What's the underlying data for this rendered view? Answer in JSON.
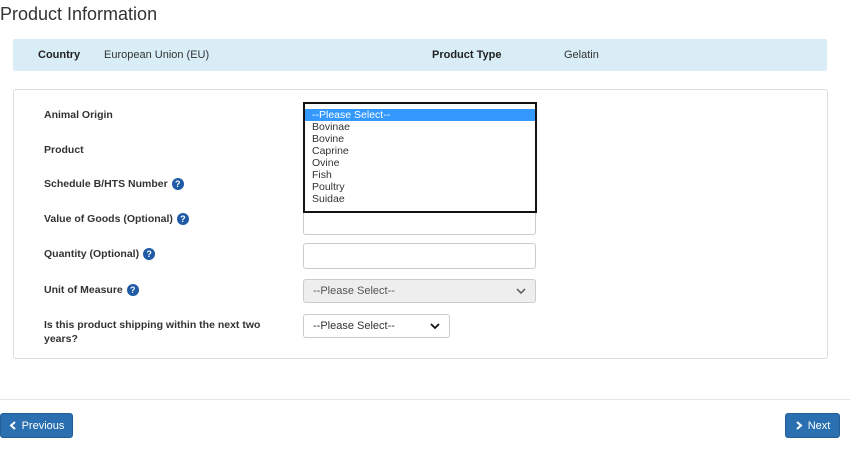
{
  "page": {
    "title": "Product Information"
  },
  "summary": {
    "country_label": "Country",
    "country_value": "European Union (EU)",
    "product_type_label": "Product Type",
    "product_type_value": "Gelatin"
  },
  "form": {
    "animal_origin": {
      "label": "Animal Origin",
      "options": [
        "--Please Select--",
        "Bovinae",
        "Bovine",
        "Caprine",
        "Ovine",
        "Fish",
        "Poultry",
        "Suidae"
      ],
      "selected": "--Please Select--"
    },
    "product": {
      "label": "Product"
    },
    "hts_number": {
      "label": "Schedule B/HTS Number"
    },
    "value_of_goods": {
      "label": "Value of Goods (Optional)",
      "value": ""
    },
    "quantity": {
      "label": "Quantity  (Optional)",
      "value": ""
    },
    "unit_of_measure": {
      "label": "Unit of Measure",
      "selected": "--Please Select--"
    },
    "shipping_two_years": {
      "label_line1": "Is this product shipping within the next two",
      "label_line2": "years?",
      "selected": "--Please Select--"
    }
  },
  "icons": {
    "help": "question-circle-icon",
    "chevron": "chevron-down-icon"
  },
  "nav": {
    "previous_label": "Previous",
    "next_label": "Next"
  },
  "colors": {
    "accent": "#2a6fb0",
    "summary_bg": "#d9edf7",
    "help_icon": "#1f5aa6",
    "highlight": "#3399ff"
  }
}
